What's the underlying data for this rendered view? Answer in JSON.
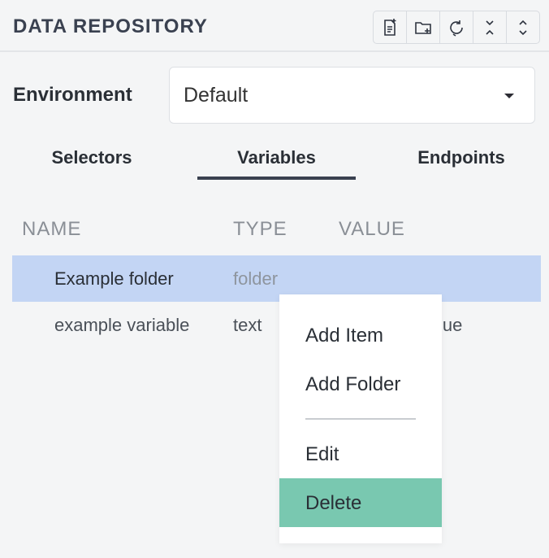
{
  "panel": {
    "title": "DATA REPOSITORY",
    "toolbar": [
      {
        "icon": "new-item-icon"
      },
      {
        "icon": "new-folder-icon"
      },
      {
        "icon": "refresh-icon"
      },
      {
        "icon": "collapse-all-icon"
      },
      {
        "icon": "expand-all-icon"
      }
    ]
  },
  "environment": {
    "label": "Environment",
    "selected": "Default"
  },
  "tabs": [
    {
      "label": "Selectors",
      "active": false
    },
    {
      "label": "Variables",
      "active": true
    },
    {
      "label": "Endpoints",
      "active": false
    }
  ],
  "table": {
    "columns": [
      "NAME",
      "TYPE",
      "VALUE"
    ],
    "rows": [
      {
        "name": "Example folder",
        "type": "folder",
        "value": "",
        "selected": true
      },
      {
        "name": "example variable",
        "type": "text",
        "value": "lue",
        "selected": false
      }
    ]
  },
  "context_menu": {
    "items": [
      {
        "label": "Add Item"
      },
      {
        "label": "Add Folder"
      },
      {
        "label": "Edit"
      },
      {
        "label": "Delete",
        "highlighted": true
      }
    ]
  },
  "colors": {
    "selected_row": "#c3d5f4",
    "menu_highlight": "#79c8b0",
    "background": "#f4f5f6"
  }
}
